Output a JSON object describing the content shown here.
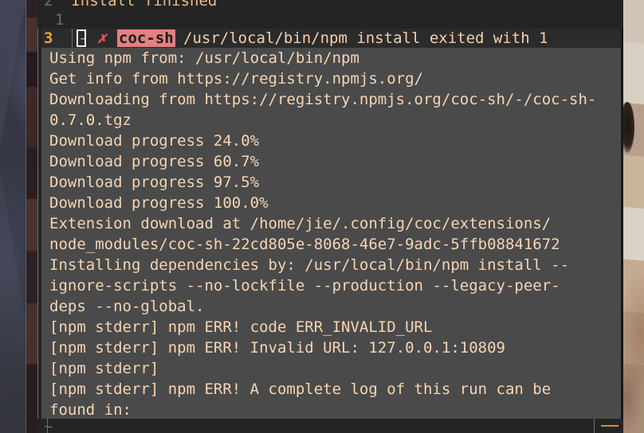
{
  "editor": {
    "clipped_top_line": {
      "line_number": "2",
      "text": "Install finished"
    },
    "blank_line_number": "1",
    "empty_buffer_marker": "~"
  },
  "popup": {
    "header": {
      "line_number": "3",
      "fold_marker": "-",
      "status_icon": "✗",
      "extension_name": "coc-sh",
      "command_text": "/usr/local/bin/npm install exited with 1",
      "status_color": "#e05252",
      "name_background": "#e38080",
      "line_number_color": "#e8a33d"
    },
    "log_lines": [
      "Using npm from: /usr/local/bin/npm",
      "Get info from https://registry.npmjs.org/",
      "Downloading from https://registry.npmjs.org/coc-sh/-/coc-sh-",
      "0.7.0.tgz",
      "Download progress 24.0%",
      "Download progress 60.7%",
      "Download progress 97.5%",
      "Download progress 100.0%",
      "Extension download at /home/jie/.config/coc/extensions/",
      "node_modules/coc-sh-22cd805e-8068-46e7-9adc-5ffb08841672",
      "Installing dependencies by: /usr/local/bin/npm install --",
      "ignore-scripts --no-lockfile --production --legacy-peer-",
      "deps --no-global.",
      "[npm stderr] npm ERR! code ERR_INVALID_URL",
      "[npm stderr] npm ERR! Invalid URL: 127.0.0.1:10809",
      "[npm stderr]",
      "[npm stderr] npm ERR! A complete log of this run can be",
      "found in:"
    ]
  },
  "theme": {
    "terminal_background": "#242424",
    "popup_background": "#4a4a4a",
    "log_text": "#f6d5b4",
    "gutter_text": "#6e6e6e",
    "accent": "#e08a2e"
  }
}
